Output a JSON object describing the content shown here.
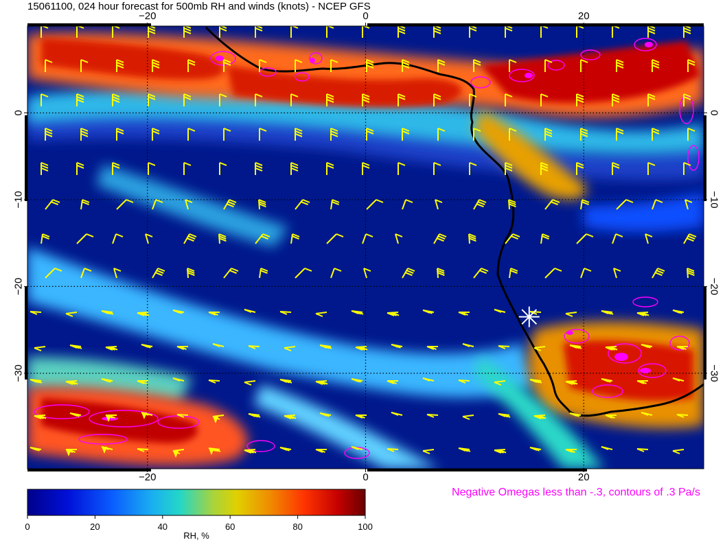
{
  "title": "15061100, 024 hour forecast for 500mb RH and winds (knots) - NCEP GFS",
  "map": {
    "lon_range": [
      -31,
      31
    ],
    "lat_range": [
      -41,
      10
    ],
    "lon_ticks": [
      {
        "value": -20,
        "label": "−20"
      },
      {
        "value": 0,
        "label": "0"
      },
      {
        "value": 20,
        "label": "20"
      }
    ],
    "lat_ticks": [
      {
        "value": 0,
        "label": "0"
      },
      {
        "value": -10,
        "label": "−10"
      },
      {
        "value": -20,
        "label": "−20"
      },
      {
        "value": -30,
        "label": "−30"
      }
    ],
    "gridlines": true,
    "station_marker": {
      "lon": 15,
      "lat": -23.5,
      "symbol": "asterisk"
    }
  },
  "colorbar": {
    "ticks": [
      "0",
      "20",
      "40",
      "60",
      "80",
      "100"
    ],
    "label": "RH, %",
    "range": [
      0,
      100
    ]
  },
  "omega_note": "Negative Omegas less than -.3, contours of .3 Pa/s",
  "colors": {
    "barb": "#ffff00",
    "omega": "#ff00ff",
    "coast": "#000000",
    "ocean_dry": "#00188c",
    "marker": "#ffffff"
  }
}
